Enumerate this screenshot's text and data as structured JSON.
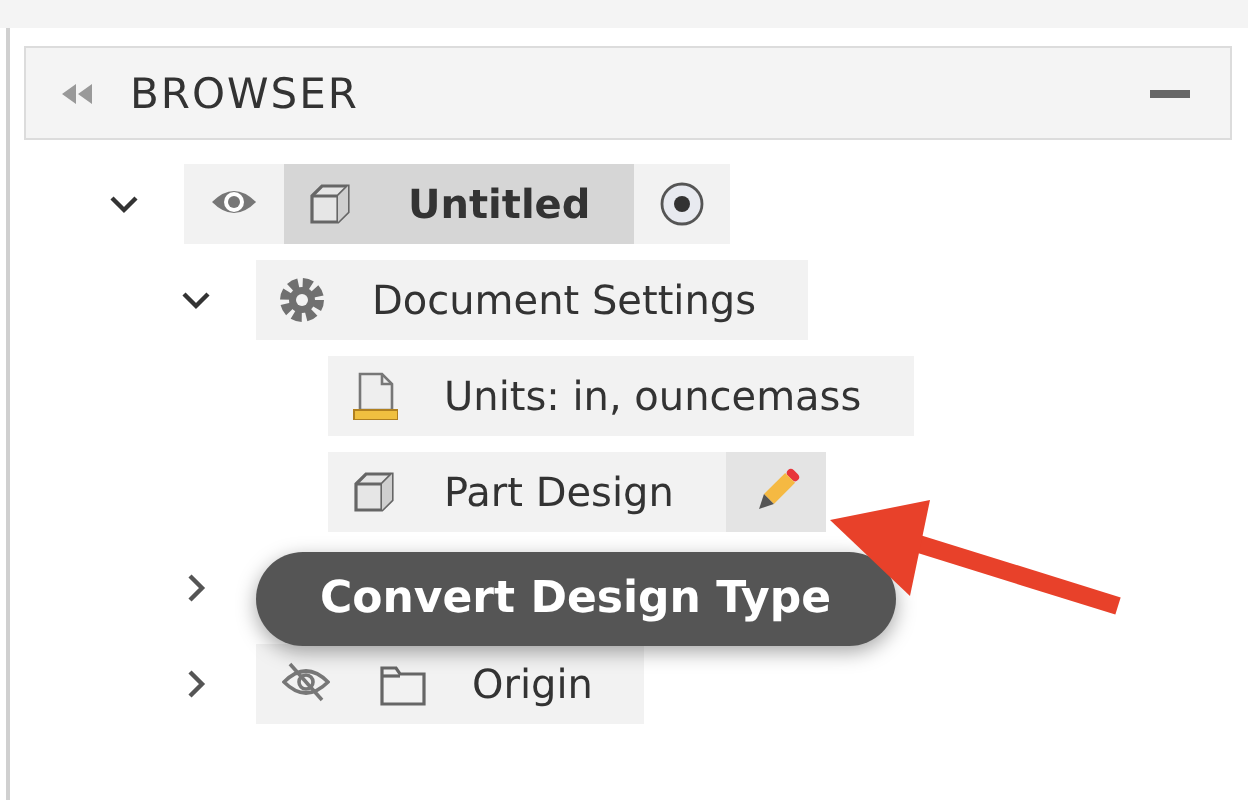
{
  "panel": {
    "title": "BROWSER"
  },
  "tree": [
    {
      "label": "Untitled",
      "kind": "body",
      "visible": true,
      "active": true,
      "radio": true,
      "expanded": true,
      "children": [
        {
          "label": "Document Settings",
          "kind": "gear",
          "expanded": true,
          "children": [
            {
              "label": "Units: in, ouncemass",
              "kind": "units"
            },
            {
              "label": "Part Design",
              "kind": "body",
              "edit": true
            }
          ]
        },
        {
          "expanded": false
        },
        {
          "label": "Origin",
          "kind": "folder",
          "visible": false,
          "expanded": false
        }
      ]
    }
  ],
  "tooltip": {
    "text": "Convert Design Type"
  }
}
